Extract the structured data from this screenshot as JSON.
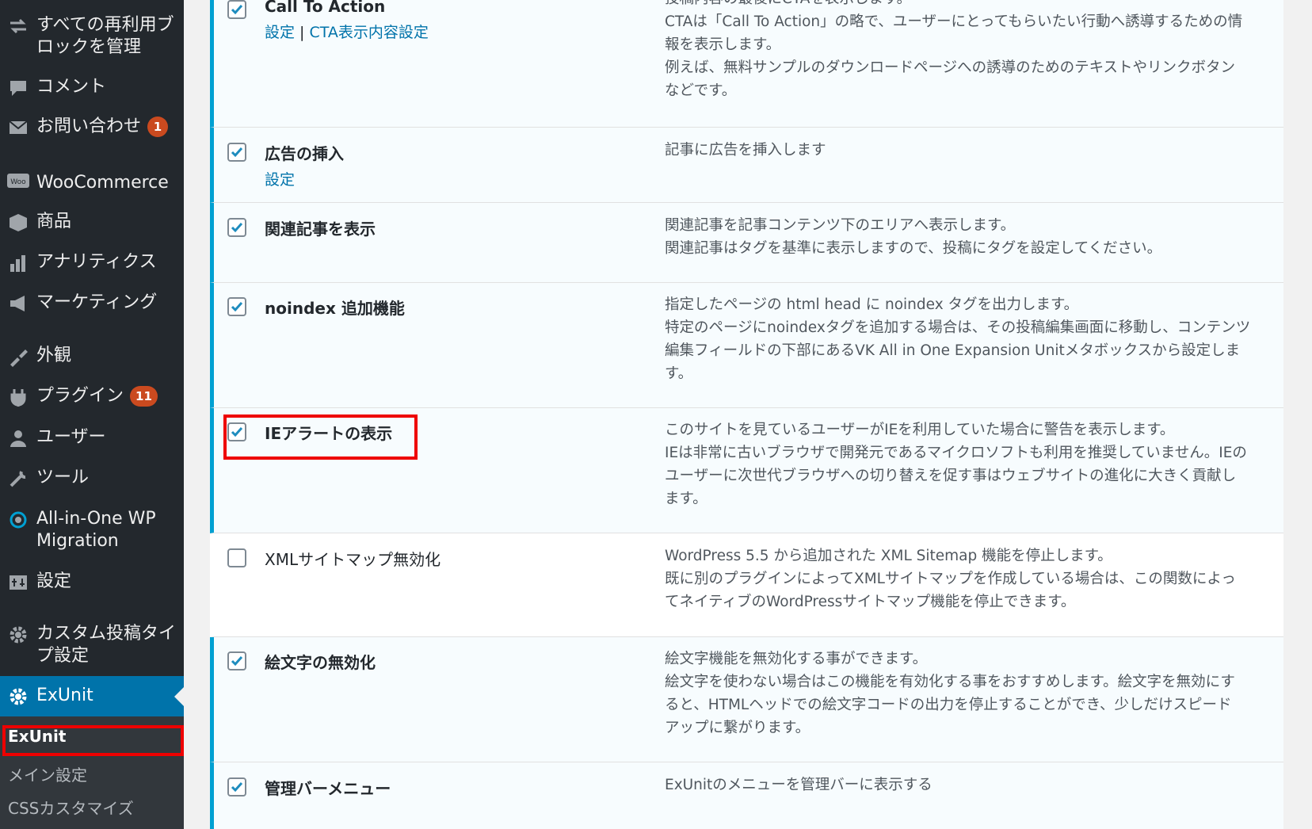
{
  "sidebar": {
    "items": [
      {
        "icon": "reusable-blocks-icon",
        "label": "すべての再利用ブロックを管理"
      },
      {
        "icon": "comment-icon",
        "label": "コメント"
      },
      {
        "icon": "mail-icon",
        "label": "お問い合わせ",
        "badge": "1"
      },
      {
        "icon": "woocommerce-icon",
        "label": "WooCommerce"
      },
      {
        "icon": "products-icon",
        "label": "商品"
      },
      {
        "icon": "analytics-icon",
        "label": "アナリティクス"
      },
      {
        "icon": "marketing-icon",
        "label": "マーケティング"
      },
      {
        "icon": "appearance-icon",
        "label": "外観"
      },
      {
        "icon": "plugins-icon",
        "label": "プラグイン",
        "badge": "11"
      },
      {
        "icon": "users-icon",
        "label": "ユーザー"
      },
      {
        "icon": "tools-icon",
        "label": "ツール"
      },
      {
        "icon": "migration-icon",
        "label": "All-in-One WP Migration"
      },
      {
        "icon": "settings-icon",
        "label": "設定"
      },
      {
        "icon": "gear-icon",
        "label": "カスタム投稿タイプ設定"
      },
      {
        "icon": "gear-icon",
        "label": "ExUnit"
      }
    ],
    "submenu": [
      "ExUnit",
      "メイン設定",
      "CSSカスタマイズ"
    ]
  },
  "rows": [
    {
      "checked": true,
      "title": "Call To Action",
      "links": [
        "設定",
        "CTA表示内容設定"
      ],
      "desc": [
        "投稿内容の最後にCTAを表示します。",
        "CTAは「Call To Action」の略で、ユーザーにとってもらいたい行動へ誘導するための情",
        "報を表示します。",
        "例えば、無料サンプルのダウンロードページへの誘導のためのテキストやリンクボタン",
        "などです。"
      ]
    },
    {
      "checked": true,
      "title": "広告の挿入",
      "links": [
        "設定"
      ],
      "desc": [
        "記事に広告を挿入します"
      ]
    },
    {
      "checked": true,
      "title": "関連記事を表示",
      "desc": [
        "関連記事を記事コンテンツ下のエリアへ表示します。",
        "関連記事はタグを基準に表示しますので、投稿にタグを設定してください。"
      ]
    },
    {
      "checked": true,
      "title": "noindex 追加機能",
      "desc": [
        "指定したページの html head に noindex タグを出力します。",
        "特定のページにnoindexタグを追加する場合は、その投稿編集画面に移動し、コンテンツ",
        "編集フィールドの下部にあるVK All in One Expansion Unitメタボックスから設定しま",
        "す。"
      ]
    },
    {
      "checked": true,
      "title": "IEアラートの表示",
      "desc": [
        "このサイトを見ているユーザーがIEを利用していた場合に警告を表示します。",
        "IEは非常に古いブラウザで開発元であるマイクロソフトも利用を推奨していません。IEの",
        "ユーザーに次世代ブラウザへの切り替えを促す事はウェブサイトの進化に大きく貢献し",
        "ます。"
      ]
    },
    {
      "checked": false,
      "title": "XMLサイトマップ無効化",
      "desc": [
        "WordPress 5.5 から追加された XML Sitemap 機能を停止します。",
        "既に別のプラグインによってXMLサイトマップを作成している場合は、この関数によっ",
        "てネイティブのWordPressサイトマップ機能を停止できます。"
      ]
    },
    {
      "checked": true,
      "title": "絵文字の無効化",
      "desc": [
        "絵文字機能を無効化する事ができます。",
        "絵文字を使わない場合はこの機能を有効化する事をおすすめします。絵文字を無効にす",
        "ると、HTMLヘッドでの絵文字コードの出力を停止することができ、少しだけスピード",
        "アップに繋がります。"
      ]
    },
    {
      "checked": true,
      "title": "管理バーメニュー",
      "desc": [
        "ExUnitのメニューを管理バーに表示する"
      ]
    }
  ]
}
